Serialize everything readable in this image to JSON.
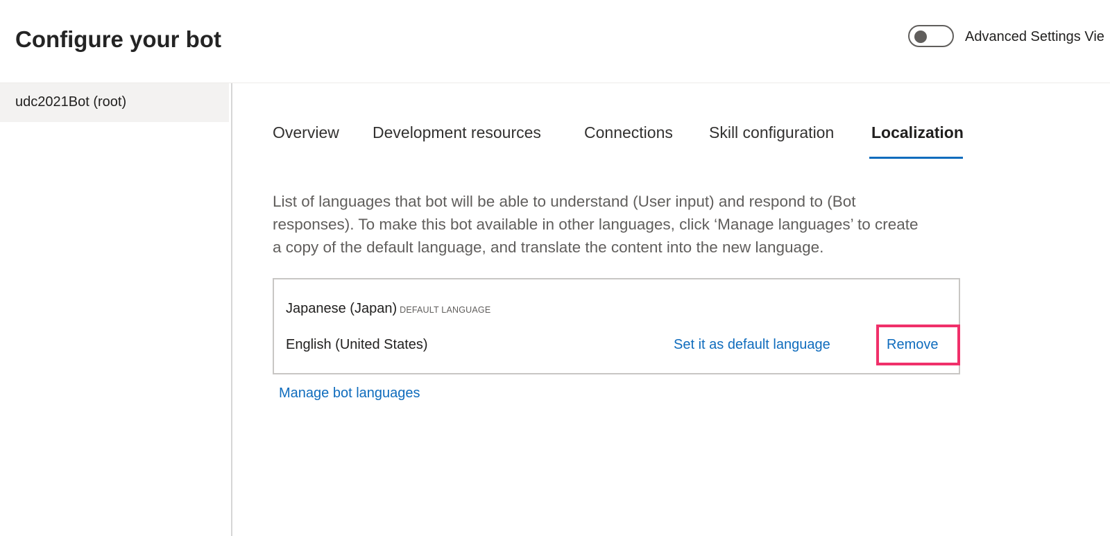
{
  "header": {
    "title": "Configure your bot",
    "toggle": {
      "label": "Advanced Settings Vie",
      "on": false
    }
  },
  "sidebar": {
    "items": [
      {
        "label": "udc2021Bot (root)",
        "selected": true
      }
    ]
  },
  "tabs": [
    {
      "label": "Overview",
      "active": false
    },
    {
      "label": "Development resources",
      "active": false
    },
    {
      "label": "Connections",
      "active": false
    },
    {
      "label": "Skill configuration",
      "active": false
    },
    {
      "label": "Localization",
      "active": true
    }
  ],
  "localization": {
    "description_lines": [
      "List of languages that bot will be able to understand (User input) and respond to (Bot",
      "responses). To make this bot available in other languages, click ‘Manage languages’ to create",
      "a copy of the default language, and translate the content into the new language."
    ],
    "languages": [
      {
        "name": "Japanese (Japan)",
        "badge": "DEFAULT LANGUAGE"
      },
      {
        "name": "English (United States)",
        "set_default_label": "Set it as default language",
        "remove_label": "Remove"
      }
    ],
    "manage_label": "Manage bot languages"
  },
  "colors": {
    "accent": "#0f6cbd",
    "highlight": "#f0306a",
    "sidebar_selected_bg": "#f3f2f1"
  }
}
